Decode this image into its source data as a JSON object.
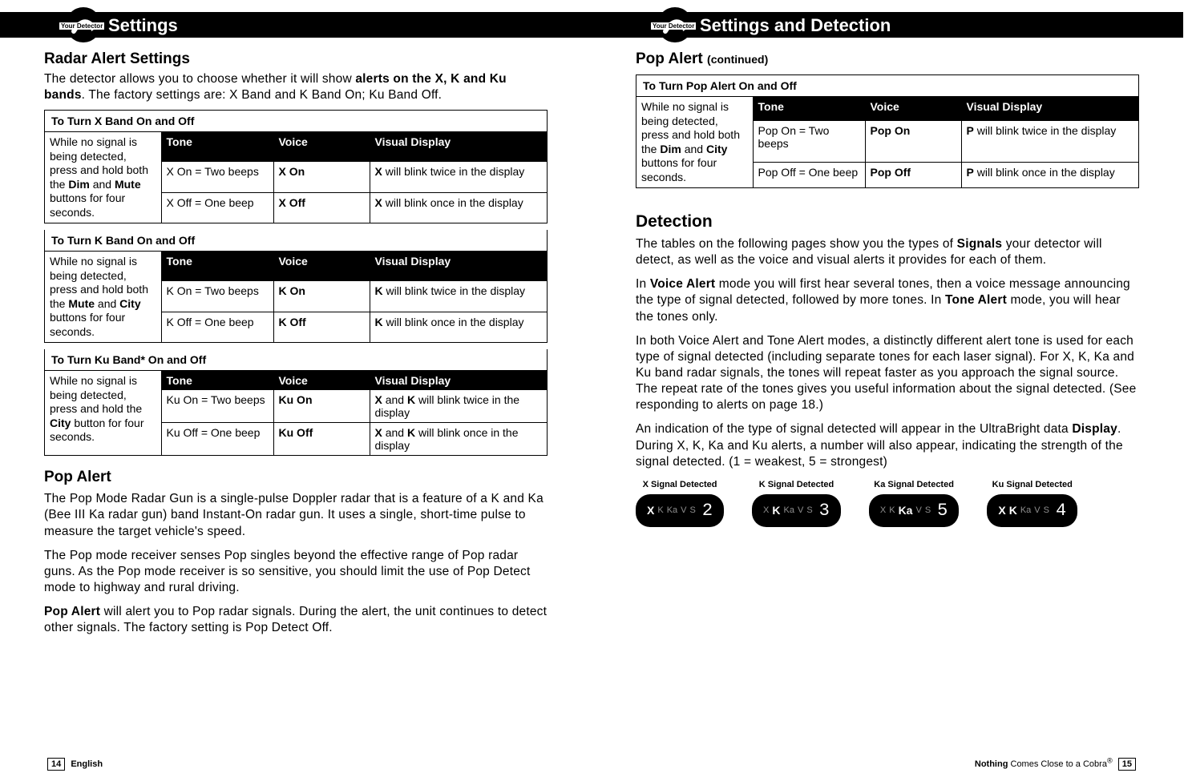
{
  "left": {
    "headerSub": "Your Detector",
    "headerTitle": "Settings",
    "radarTitle": "Radar Alert Settings",
    "radarIntro": "The detector allows you to choose whether it will show alerts on the X, K and Ku bands. The factory settings are: X Band and K Band On; Ku Band Off.",
    "xband": {
      "title": "To Turn X Band On and Off",
      "leftText": "While no signal is being detected, press and hold both the Dim and Mute buttons for four seconds.",
      "h1": "Tone",
      "h2": "Voice",
      "h3": "Visual Display",
      "r1c1": "X On = Two beeps",
      "r1c2": "X On",
      "r1c3": "X will blink twice in the display",
      "r2c1": "X Off = One beep",
      "r2c2": "X Off",
      "r2c3": "X will blink once in the display"
    },
    "kband": {
      "title": "To Turn K Band On and Off",
      "leftText": "While no signal is being detected, press and hold both the Mute and City buttons for four seconds.",
      "h1": "Tone",
      "h2": "Voice",
      "h3": "Visual Display",
      "r1c1": "K On = Two beeps",
      "r1c2": "K On",
      "r1c3": "K will blink twice in the display",
      "r2c1": "K Off = One beep",
      "r2c2": "K Off",
      "r2c3": "K will blink once in the display"
    },
    "kuband": {
      "title": "To Turn Ku Band* On and Off",
      "leftText": "While no signal is being detected, press and hold the City button for four seconds.",
      "h1": "Tone",
      "h2": "Voice",
      "h3": "Visual Display",
      "r1c1": "Ku On = Two beeps",
      "r1c2": "Ku On",
      "r1c3": "X and K will blink twice in the display",
      "r2c1": "Ku Off = One beep",
      "r2c2": "Ku Off",
      "r2c3": "X and K will blink once in the display"
    },
    "popTitle": "Pop Alert",
    "pop1": "The Pop Mode Radar Gun is a single-pulse Doppler radar that is a feature of a K and Ka (Bee III Ka radar gun) band Instant-On radar gun. It uses a single, short-time pulse to measure the target vehicle's speed.",
    "pop2": "The Pop mode receiver senses Pop singles beyond the effective range of Pop radar guns. As the Pop mode receiver is so sensitive, you should limit the use of Pop Detect mode to highway and rural driving.",
    "pop3": "Pop Alert will alert you to Pop radar signals. During the alert, the unit continues to detect other signals. The factory setting is Pop Detect Off.",
    "footerPage": "14",
    "footerText": "English"
  },
  "right": {
    "headerSub": "Your Detector",
    "headerTitle": "Settings and Detection",
    "popContTitle": "Pop Alert (continued)",
    "poptable": {
      "title": "To Turn Pop Alert On and Off",
      "leftText": "While no signal is being detected, press and hold both the Dim and City buttons for four seconds.",
      "h1": "Tone",
      "h2": "Voice",
      "h3": "Visual Display",
      "r1c1": "Pop On = Two beeps",
      "r1c2": "Pop On",
      "r1c3": "P will blink twice in the display",
      "r2c1": "Pop Off = One beep",
      "r2c2": "Pop Off",
      "r2c3": "P will blink once in the display"
    },
    "detTitle": "Detection",
    "det1": "The tables on the following pages show you the types of Signals your detector will detect, as well as the voice and visual alerts it provides for each of them.",
    "det2": "In Voice Alert mode you will first hear several tones, then a voice message announcing the type of signal detected, followed by more tones. In Tone Alert mode, you will hear the tones only.",
    "det3": "In both Voice Alert and Tone Alert modes, a distinctly different alert tone is used for each type of signal detected (including separate tones for each laser signal). For X, K, Ka and Ku band radar signals, the tones will repeat faster as you approach the signal source. The repeat rate of the tones gives you useful information about the signal detected. (See responding to alerts on page 18.)",
    "det4": "An indication of the type of signal detected will appear in the UltraBright data Display. During X, K, Ka and Ku alerts, a number will also appear, indicating the strength of the signal detected. (1 = weakest, 5 = strongest)",
    "badges": [
      {
        "label": "X Signal Detected",
        "bands": [
          "X",
          "K",
          "Ka",
          "V",
          "S"
        ],
        "bold": 0,
        "num": "2"
      },
      {
        "label": "K Signal Detected",
        "bands": [
          "X",
          "K",
          "Ka",
          "V",
          "S"
        ],
        "bold": 1,
        "num": "3"
      },
      {
        "label": "Ka Signal Detected",
        "bands": [
          "X",
          "K",
          "Ka",
          "V",
          "S"
        ],
        "bold": 2,
        "num": "5"
      },
      {
        "label": "Ku Signal Detected",
        "bands": [
          "X",
          "K",
          "Ka",
          "V",
          "S"
        ],
        "bold": 0,
        "num": "4",
        "boldAlso": 1
      }
    ],
    "footerText": "Nothing Comes Close to a Cobra®",
    "footerPage": "15"
  }
}
